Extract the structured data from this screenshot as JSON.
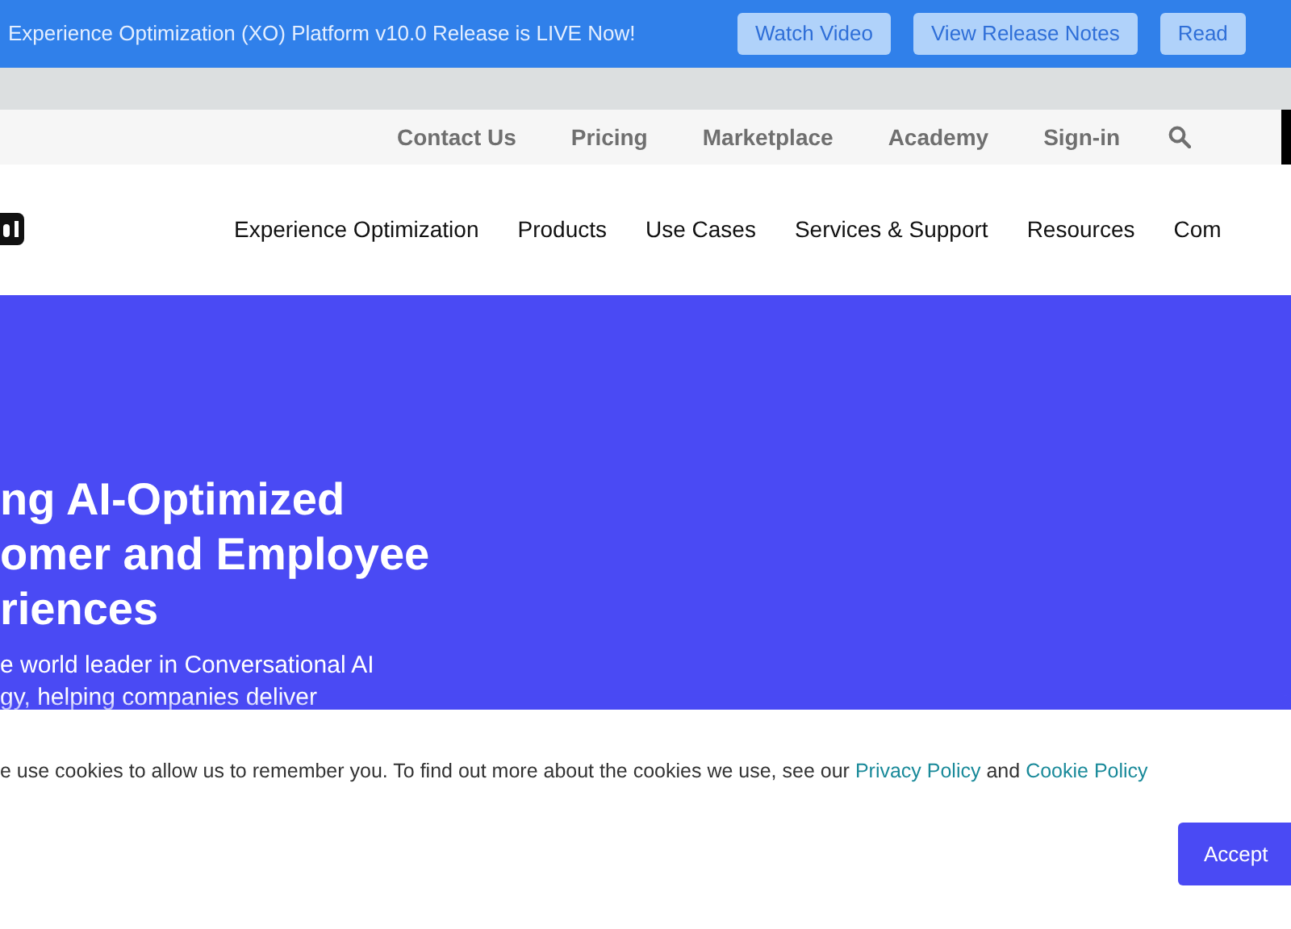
{
  "announcement": {
    "text": "Experience Optimization (XO) Platform v10.0 Release is LIVE Now!",
    "buttons": [
      "Watch Video",
      "View Release Notes",
      "Read"
    ]
  },
  "utility_nav": {
    "items": [
      "Contact Us",
      "Pricing",
      "Marketplace",
      "Academy",
      "Sign-in"
    ]
  },
  "main_nav": {
    "items": [
      "Experience Optimization",
      "Products",
      "Use Cases",
      "Services & Support",
      "Resources",
      "Com"
    ]
  },
  "hero": {
    "heading_lines": [
      "ng AI-Optimized",
      "omer and Employee",
      "riences"
    ],
    "body_lines": [
      "e world leader in Conversational AI",
      "gy, helping companies deliver"
    ]
  },
  "cookie_banner": {
    "text": "e use cookies to allow us to remember you. To find out more about the cookies we use, see our",
    "links": [
      "Privacy Policy",
      "Cookie Policy"
    ],
    "joiner": "and",
    "button": "Accept"
  }
}
